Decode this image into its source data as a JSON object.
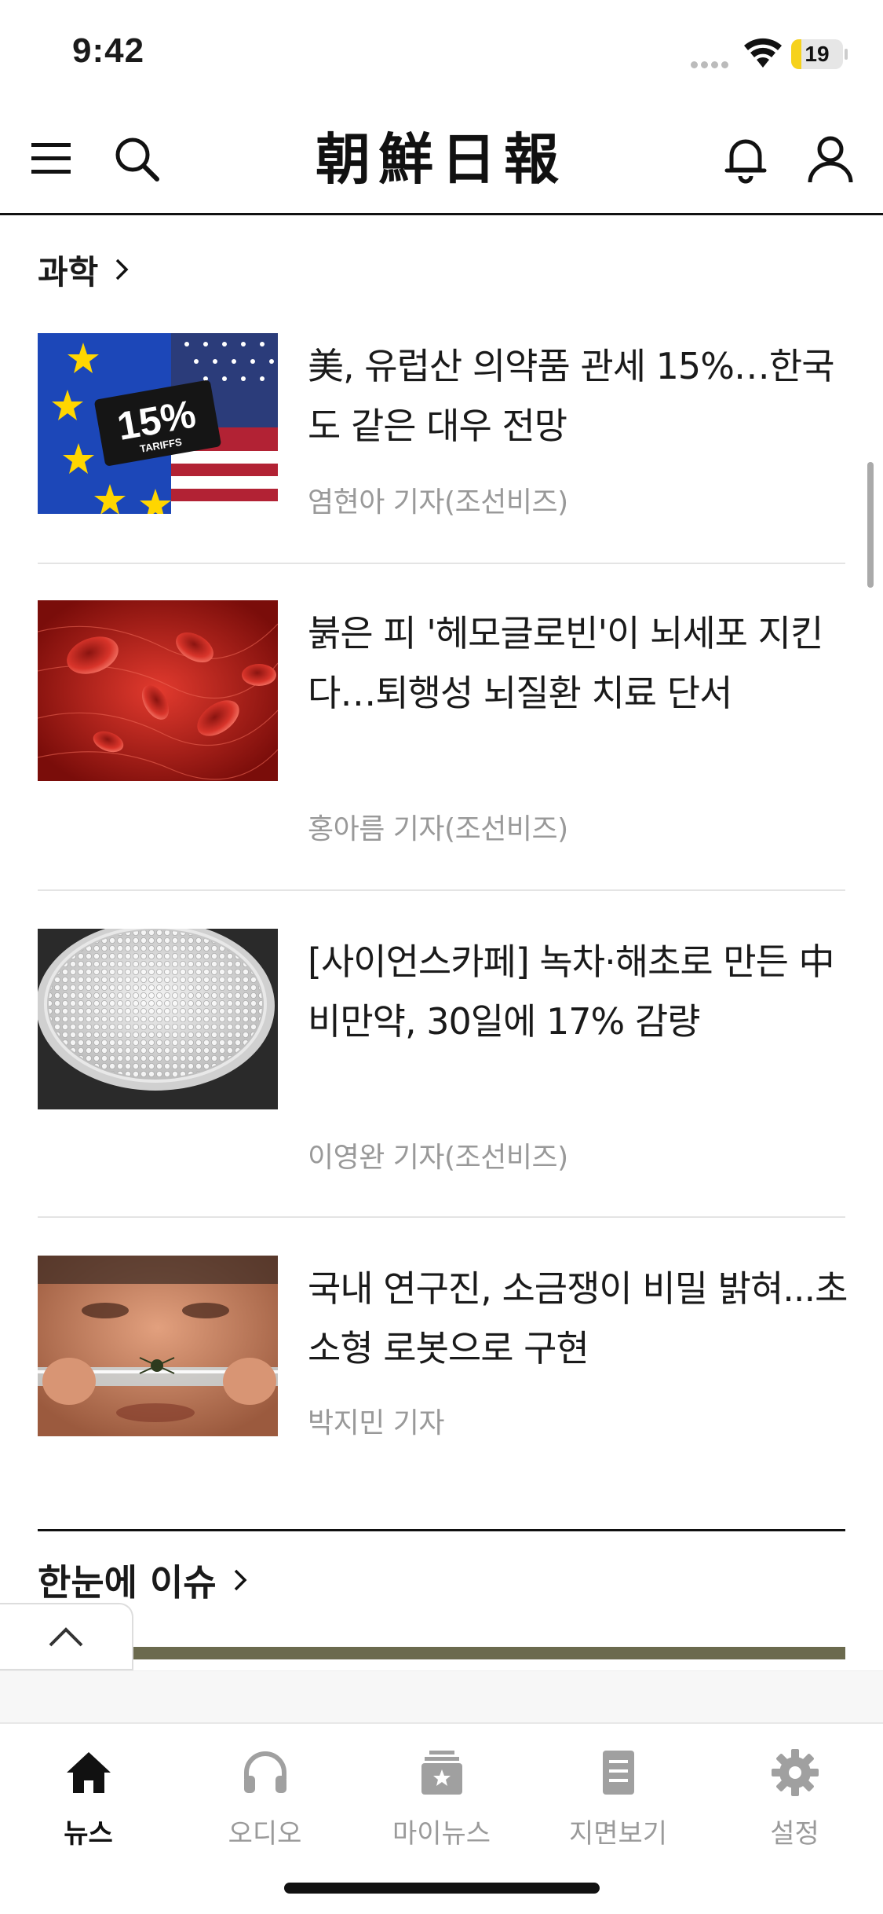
{
  "status_bar": {
    "time": "9:42",
    "battery": "19",
    "battery_level": 0.19
  },
  "header": {
    "logo": "朝鮮日報",
    "icons": {
      "menu": "hamburger-menu-icon",
      "search": "search-icon",
      "notifications": "bell-icon",
      "account": "person-icon"
    }
  },
  "section": {
    "title": "과학"
  },
  "articles": [
    {
      "title": "美, 유럽산 의약품 관세 15%…한국도 같은 대우 전망",
      "byline": "염현아 기자(조선비즈)",
      "thumb_text": "15%",
      "thumb_sub": "TARIFFS"
    },
    {
      "title": "붉은 피 '헤모글로빈'이 뇌세포 지킨다…퇴행성 뇌질환 치료 단서",
      "byline": "홍아름 기자(조선비즈)"
    },
    {
      "title": "[사이언스카페] 녹차·해초로 만든 中 비만약, 30일에 17% 감량",
      "byline": "이영완 기자(조선비즈)"
    },
    {
      "title": "국내 연구진, 소금쟁이 비밀 밝혀...초소형 로봇으로 구현",
      "byline": "박지민 기자"
    }
  ],
  "section2": {
    "title": "한눈에 이슈"
  },
  "tabbar": {
    "tabs": [
      {
        "label": "뉴스",
        "icon": "home-icon",
        "active": true
      },
      {
        "label": "오디오",
        "icon": "headphones-icon",
        "active": false
      },
      {
        "label": "마이뉴스",
        "icon": "star-box-icon",
        "active": false
      },
      {
        "label": "지면보기",
        "icon": "document-icon",
        "active": false
      },
      {
        "label": "설정",
        "icon": "gear-icon",
        "active": false
      }
    ]
  },
  "colors": {
    "accent": "#111111",
    "muted": "#999999",
    "battery": "#f6d21c"
  }
}
